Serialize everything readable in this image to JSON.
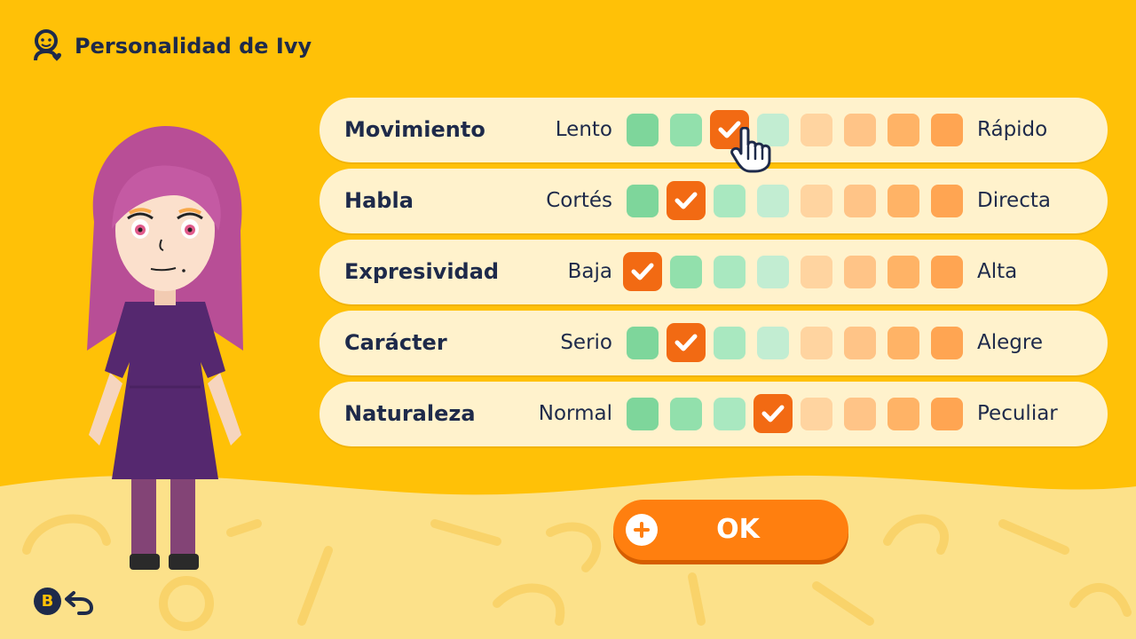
{
  "header": {
    "title": "Personalidad de Ivy",
    "icon": "person-heart-icon"
  },
  "traits": [
    {
      "name": "Movimiento",
      "left": "Lento",
      "right": "Rápido",
      "selected": 3
    },
    {
      "name": "Habla",
      "left": "Cortés",
      "right": "Directa",
      "selected": 2
    },
    {
      "name": "Expresividad",
      "left": "Baja",
      "right": "Alta",
      "selected": 1
    },
    {
      "name": "Carácter",
      "left": "Serio",
      "right": "Alegre",
      "selected": 2
    },
    {
      "name": "Naturaleza",
      "left": "Normal",
      "right": "Peculiar",
      "selected": 4
    }
  ],
  "scale_colors": [
    "#7ED69B",
    "#92E0AC",
    "#A9E8C0",
    "#C2EDD2",
    "#FFD4A0",
    "#FFC487",
    "#FFB366",
    "#FFA552"
  ],
  "selected_color": "#F26A13",
  "ok_button": {
    "label": "OK",
    "icon": "plus-circle-icon"
  },
  "footer": {
    "b_label": "B",
    "back_icon": "undo-arrow-icon"
  }
}
